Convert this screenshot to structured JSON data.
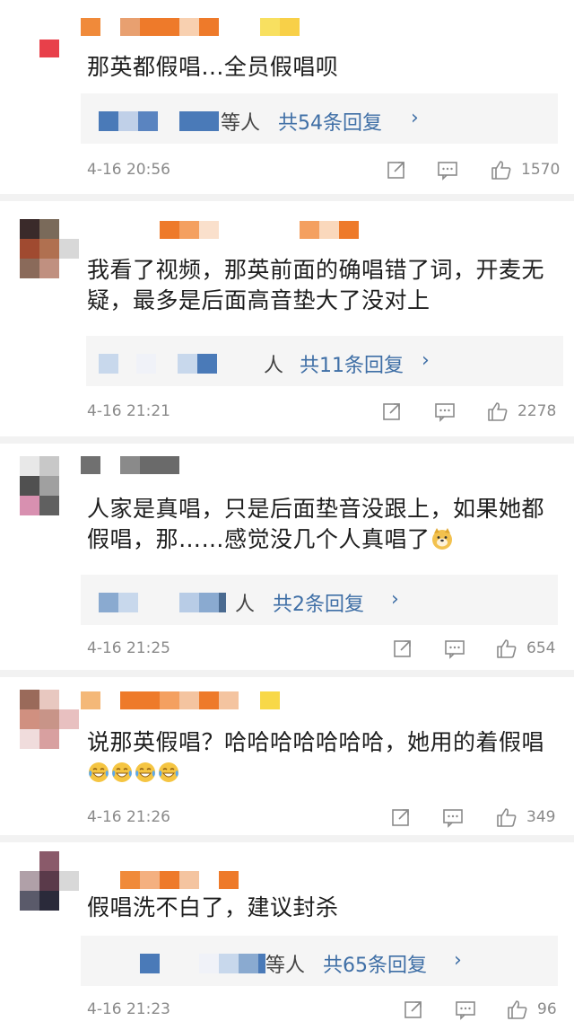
{
  "comments": [
    {
      "text": "那英都假唱...全员假唱呗",
      "reply_who": "等人",
      "reply_count": "共54条回复",
      "chevron": "›",
      "time": "4-16 20:56",
      "likes": "1570"
    },
    {
      "text": "我看了视频，那英前面的确唱错了词，开麦无疑，最多是后面高音垫大了没对上",
      "reply_who": "人",
      "reply_count": "共11条回复",
      "chevron": "›",
      "time": "4-16 21:21",
      "likes": "2278"
    },
    {
      "text": "人家是真唱，只是后面垫音没跟上，如果她都假唱，那……感觉没几个人真唱了",
      "emoji": "doge-emoji",
      "reply_who": "人",
      "reply_count": "共2条回复",
      "chevron": "›",
      "time": "4-16 21:25",
      "likes": "654"
    },
    {
      "text": "说那英假唱？哈哈哈哈哈哈哈，她用的着假唱",
      "emoji": "laugh-cry-emoji x4",
      "reply_who": "",
      "reply_count": "",
      "time": "4-16 21:26",
      "likes": "349"
    },
    {
      "text": "假唱洗不白了，建议封杀",
      "reply_who": "等人",
      "reply_count": "共65条回复",
      "chevron": "›",
      "time": "4-16 21:23",
      "likes": "96"
    }
  ],
  "icons": {
    "repost": "repost-icon",
    "comment": "comment-icon",
    "like": "thumbs-up-icon"
  },
  "colors": {
    "link": "#3f6fa6",
    "meta": "#8a8a8a",
    "reply_bg": "#f5f5f5"
  }
}
